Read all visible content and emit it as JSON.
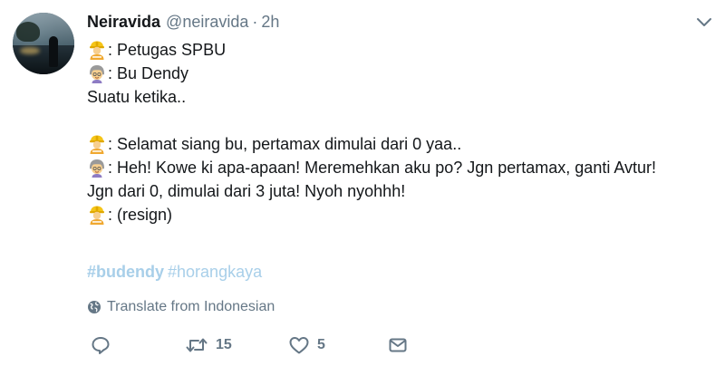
{
  "tweet": {
    "author": {
      "name": "Neiravida",
      "handle": "@neiravida",
      "avatar_icon": "avatar-photo-beach-silhouette"
    },
    "separator": "·",
    "time": "2h",
    "lines": [
      {
        "emoji": "construction-worker-emoji",
        "text": ": Petugas SPBU"
      },
      {
        "emoji": "older-woman-emoji",
        "text": ": Bu Dendy"
      },
      {
        "emoji": "",
        "text": "Suatu ketika.."
      },
      {
        "emoji": "",
        "text": ""
      },
      {
        "emoji": "construction-worker-emoji",
        "text": ": Selamat siang bu, pertamax dimulai dari 0 yaa.."
      },
      {
        "emoji": "older-woman-emoji",
        "text": ": Heh! Kowe ki apa-apaan! Meremehkan aku po? Jgn pertamax, ganti Avtur!"
      },
      {
        "emoji": "",
        "text": "Jgn dari 0, dimulai dari 3 juta! Nyoh nyohhh!"
      },
      {
        "emoji": "construction-worker-emoji",
        "text": ": (resign)"
      }
    ],
    "hashtags": [
      "#budendy",
      "#horangkaya"
    ],
    "translate_label": "Translate from Indonesian",
    "actions": {
      "reply_count": "",
      "retweet_count": "15",
      "like_count": "5"
    }
  },
  "colors": {
    "text": "#14171a",
    "secondary": "#657786",
    "hashtag": "#a8cfe9"
  }
}
